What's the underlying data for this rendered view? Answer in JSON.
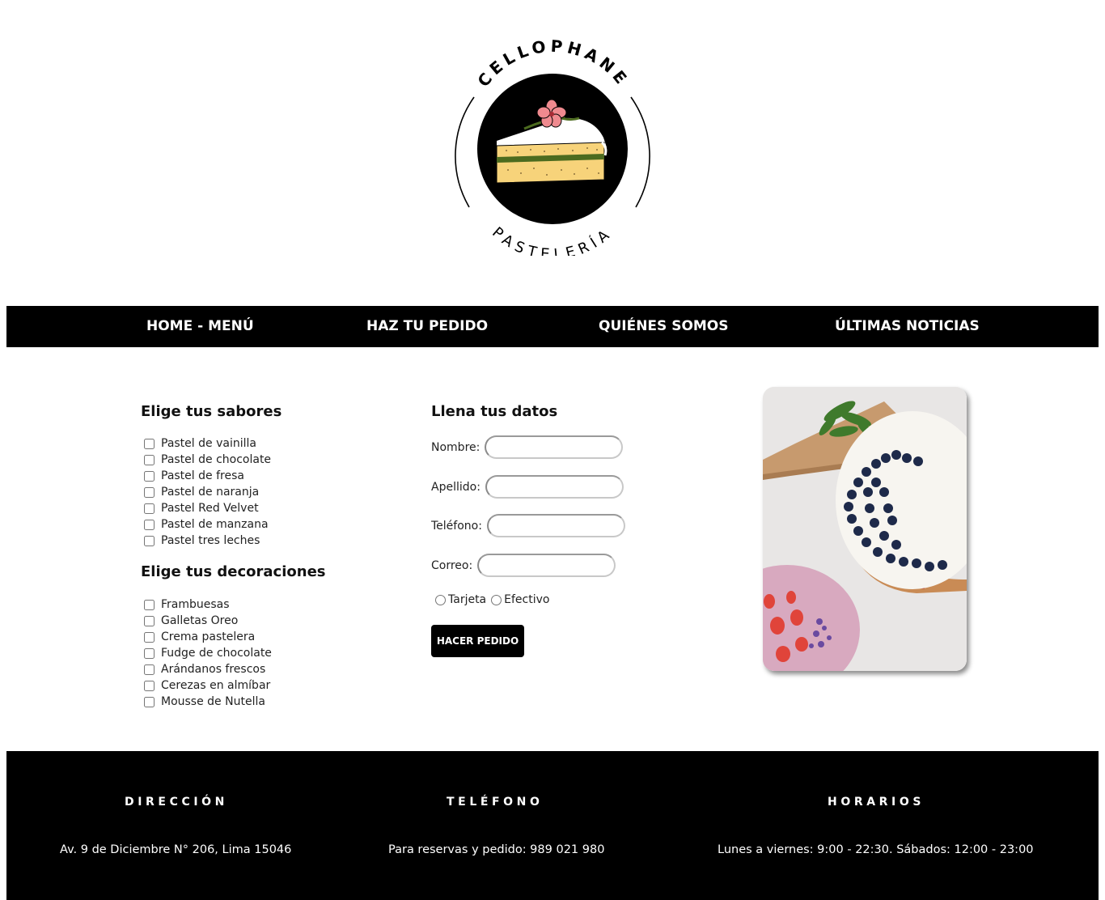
{
  "logo": {
    "top_text": "CELLOPHANE",
    "bottom_text": "PASTELERÍA"
  },
  "nav": {
    "items": [
      {
        "label": "HOME - MENÚ"
      },
      {
        "label": "HAZ TU PEDIDO"
      },
      {
        "label": "QUIÉNES SOMOS"
      },
      {
        "label": "ÚLTIMAS NOTICIAS"
      }
    ]
  },
  "flavors": {
    "title": "Elige tus sabores",
    "items": [
      "Pastel de vainilla",
      "Pastel de chocolate",
      "Pastel de fresa",
      "Pastel de naranja",
      "Pastel Red Velvet",
      "Pastel de manzana",
      "Pastel tres leches"
    ]
  },
  "decorations": {
    "title": "Elige tus decoraciones",
    "items": [
      "Frambuesas",
      "Galletas Oreo",
      "Crema pastelera",
      "Fudge de chocolate",
      "Arándanos frescos",
      "Cerezas en almíbar",
      "Mousse de Nutella"
    ]
  },
  "form": {
    "title": "Llena tus datos",
    "name_label": "Nombre:",
    "surname_label": "Apellido:",
    "phone_label": "Teléfono:",
    "email_label": "Correo:",
    "pay_card_label": "Tarjeta",
    "pay_cash_label": "Efectivo",
    "submit_label": "HACER PEDIDO"
  },
  "footer": {
    "address_heading": "DIRECCIÓN",
    "address_text": "Av. 9 de Diciembre N° 206, Lima 15046",
    "phone_heading": "TELÉFONO",
    "phone_text": "Para reservas y pedido: 989 021 980",
    "hours_heading": "HORARIOS",
    "hours_text": "Lunes a viernes: 9:00 - 22:30. Sábados: 12:00 - 23:00"
  },
  "colors": {
    "nav_bg": "#000000",
    "footer_bg": "#000000",
    "cake_sponge": "#f7d37a",
    "cake_filling": "#4c6b1f",
    "flower": "#ef8a8f"
  }
}
